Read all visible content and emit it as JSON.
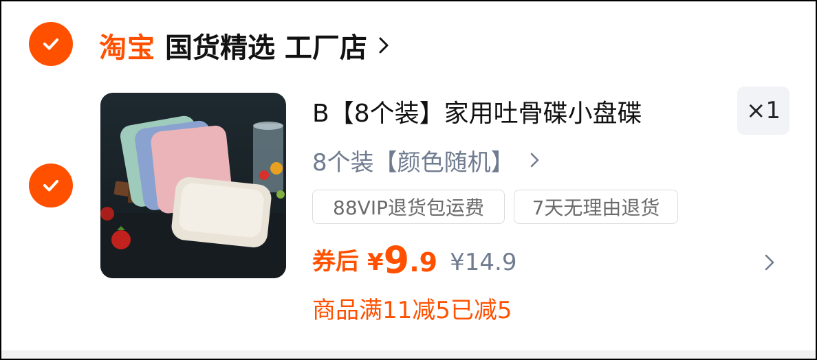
{
  "shop": {
    "logo": "淘宝",
    "name": "国货精选 工厂店",
    "checked": true
  },
  "item": {
    "checked": true,
    "image_alt": "pastel square plates on a wooden rack",
    "title": "B【8个装】家用吐骨碟小盘碟",
    "quantity": "×1",
    "sku": "8个装【颜色随机】",
    "tags": [
      "88VIP退货包运费",
      "7天无理由退货"
    ],
    "price": {
      "coupon_label": "券后",
      "currency": "¥",
      "integer": "9",
      "decimal": ".9",
      "original": "¥14.9"
    },
    "promo": "商品满11减5已减5"
  },
  "colors": {
    "accent": "#ff5000",
    "muted_text": "#6f7b8f",
    "quantity_bg": "#f2f3f7"
  },
  "icons": {
    "shop_check": "check-circle-icon",
    "item_check": "check-circle-icon",
    "shop_arrow": "chevron-right-icon",
    "sku_arrow": "chevron-right-icon",
    "row_arrow": "chevron-right-icon"
  }
}
